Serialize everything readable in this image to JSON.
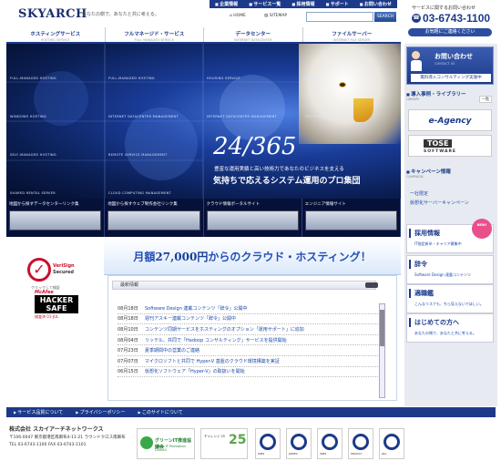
{
  "header": {
    "logo": "SKYARCH",
    "tagline": "あなたの側で、あなたと共に考える。",
    "topnav": [
      "企業情報",
      "サービス一覧",
      "採用情報",
      "サポート",
      "お問い合わせ"
    ],
    "home": "HOME",
    "sitemap": "SITEMAP",
    "search_placeholder": "",
    "search_button": "SEARCH",
    "tel_label": "サービスに関するお問い合わせ",
    "tel": "03-6743-1100",
    "contact_button": "お気軽にご連絡ください"
  },
  "categories": [
    {
      "jp": "ホスティングサービス",
      "en": "HOSTING SERVICE"
    },
    {
      "jp": "フルマネージド・サービス",
      "en": "FULL MANAGED SERVICE"
    },
    {
      "jp": "データセンター",
      "en": "INTERNET DATACENTER"
    },
    {
      "jp": "ファイルサーバー",
      "en": "INTERNET FILE SERVER"
    }
  ],
  "hero": {
    "tiles": [
      "FULL-MANAGED HOSTING",
      "FULL-MANAGED HOSTING",
      "HOUSING SERVICE",
      "PEERLY",
      "WINDOWS HOSTING",
      "INTERNET DATACENTER MANAGEMENT",
      "INTERNET DATACENTER MANAGEMENT",
      "GROUPWARE",
      "SELF-MANAGED HOSTING",
      "REMOTE SERVICE MANAGEMENT",
      "SHARED RENTAL SERVER",
      "CLOUD COMPUTING MANAGEMENT"
    ],
    "big_number": "24/365",
    "sub": "豊富な運用実績と高い技術力であなたのビジネスを支える",
    "main": "気持ちで応えるシステム運用のプロ集団"
  },
  "strip": [
    "地図から探すデータセンターリンク集",
    "地図から探すウェブ制作会社リンク集",
    "クラウド情報ポータルサイト",
    "エンジニア情報サイト"
  ],
  "badges": {
    "verisign_1": "VeriSign",
    "verisign_2": "Secured",
    "verisign_3": "クリックして検証",
    "mcafee_1": "McAfee",
    "mcafee_2": "HACKER SAFE",
    "mcafee_3": "検査済 01-JUL"
  },
  "cloud_banner": {
    "prefix": "月額",
    "price": "27,000円",
    "suffix": "からのクラウド・ホスティング！"
  },
  "news": {
    "title": "最新情報",
    "items": [
      {
        "date": "08月18日",
        "text": "Software Design 連載コンテンツ「辞令」公開中"
      },
      {
        "date": "08月18日",
        "text": "週刊アスキー連載コンテンツ「辞令」公開中"
      },
      {
        "date": "08月10日",
        "text": "コンテンツ同期サービスをホスティングのオプション「運用サポート」に追加"
      },
      {
        "date": "08月04日",
        "text": "リッテル、共同で「Hadoop コンサルティング」サービスを提供開始"
      },
      {
        "date": "07月23日",
        "text": "夏季期間中の営業のご連絡"
      },
      {
        "date": "07月07日",
        "text": "マイクロソフトと共同で Hyper-V 基盤のクラウド環境構築を実証"
      },
      {
        "date": "06月15日",
        "text": "仮想化ソフトウェア「Hyper-V」の取扱いを開始"
      }
    ]
  },
  "sidebar": {
    "contact_title": "お問い合わせ",
    "contact_en": "CONTACT US",
    "contact_note": "無料導入コンサルティング実施中",
    "cases_title": "導入事例・ライブラリー",
    "cases_en": "LIBRARY",
    "cases_more": "一覧",
    "eagency": "e-Agency",
    "tose_1": "TOSE",
    "tose_2": "SOFTWARE",
    "campaign_title": "キャンペーン情報",
    "campaign_en": "CAMPAIGN",
    "campaign_links": [
      "一社限定",
      "仮想化サーバーキャンペーン"
    ],
    "cards": [
      {
        "title": "採用情報",
        "sub": "IT指定新卒・キャリア募集中"
      },
      {
        "title": "辞令",
        "sub": "Software Design 連載コンテンツ"
      },
      {
        "title": "適職鑑",
        "sub": "こんなリスクも、ちら見えないでほしい。"
      },
      {
        "title": "はじめての方へ",
        "sub": "あなたの側で、あなたと共に考える。"
      }
    ],
    "badge": "NEW!"
  },
  "footer": {
    "links": [
      "サービス品質について",
      "プライバシーポリシー",
      "このサイトについて"
    ],
    "company": "株式会社 スカイアーチネットワークス",
    "address": "〒106-0047 東京都港区南麻布4-11-21 ラウンドクロス南麻布",
    "tel": "TEL 03-6743-1100  FAX 03-6743-1101",
    "green": "グリーンIT推進協議会",
    "green_en": "Green IT Promotion Council",
    "challenge": "チャレンジ 25",
    "challenge_num": "25",
    "logos": [
      "ISMS",
      "JIPDEC",
      "ISMS",
      "PRIVACY",
      "JQA"
    ]
  }
}
